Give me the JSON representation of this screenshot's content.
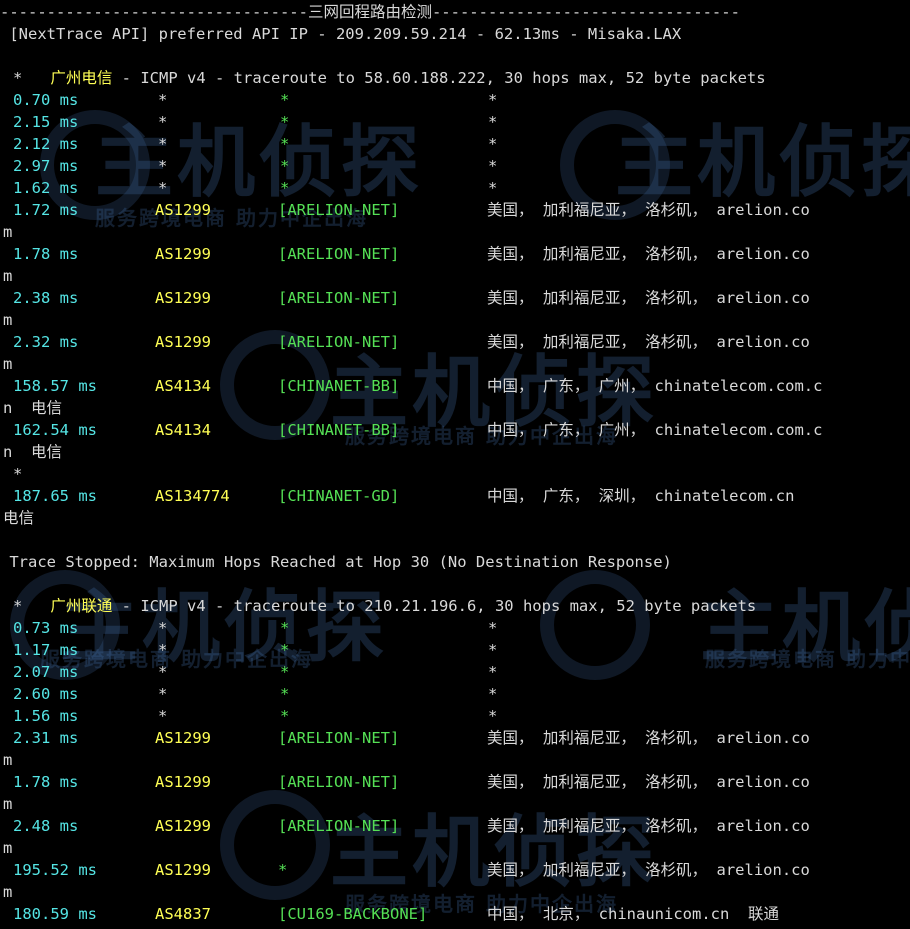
{
  "banner": "---------------------------------三网回程路由检测---------------------------------",
  "api_line": " [NextTrace API] preferred API IP - 209.209.59.214 - 62.13ms - Misaka.LAX",
  "sections": [
    {
      "carrier": "广州电信",
      "header_rest": " - ICMP v4 - traceroute to 58.60.188.222, 30 hops max, 52 byte packets",
      "icmp": "ICMP v4"
    },
    {
      "carrier": "广州联通",
      "header_rest": " - ICMP v4 - traceroute to 210.21.196.6, 30 hops max, 52 byte packets",
      "icmp": "ICMP v4"
    }
  ],
  "trace_stopped": " Trace Stopped: Maximum Hops Reached at Hop 30 (No Destination Response)",
  "star": "*",
  "rows1": [
    {
      "lat": "0.70 ms",
      "as": "*",
      "net": "*",
      "geo": "*"
    },
    {
      "lat": "2.15 ms",
      "as": "*",
      "net": "*",
      "geo": "*"
    },
    {
      "lat": "2.12 ms",
      "as": "*",
      "net": "*",
      "geo": "*"
    },
    {
      "lat": "2.97 ms",
      "as": "*",
      "net": "*",
      "geo": "*"
    },
    {
      "lat": "1.62 ms",
      "as": "*",
      "net": "*",
      "geo": "*"
    },
    {
      "lat": "1.72 ms",
      "as": "AS1299",
      "net": "[ARELION-NET]",
      "geo": "美国， 加利福尼亚， 洛杉矶， arelion.co",
      "wrap": "m"
    },
    {
      "lat": "1.78 ms",
      "as": "AS1299",
      "net": "[ARELION-NET]",
      "geo": "美国， 加利福尼亚， 洛杉矶， arelion.co",
      "wrap": "m"
    },
    {
      "lat": "2.38 ms",
      "as": "AS1299",
      "net": "[ARELION-NET]",
      "geo": "美国， 加利福尼亚， 洛杉矶， arelion.co",
      "wrap": "m"
    },
    {
      "lat": "2.32 ms",
      "as": "AS1299",
      "net": "[ARELION-NET]",
      "geo": "美国， 加利福尼亚， 洛杉矶， arelion.co",
      "wrap": "m"
    },
    {
      "lat": "158.57 ms",
      "as": "AS4134",
      "net": "[CHINANET-BB]",
      "geo": "中国， 广东， 广州， chinatelecom.com.c",
      "wrap": "n  电信"
    },
    {
      "lat": "162.54 ms",
      "as": "AS4134",
      "net": "[CHINANET-BB]",
      "geo": "中国， 广东， 广州， chinatelecom.com.c",
      "wrap": "n  电信"
    },
    {
      "lat": "187.65 ms",
      "as": "AS134774",
      "net": "[CHINANET-GD]",
      "geo": "中国， 广东， 深圳， chinatelecom.cn",
      "wrap": "电信"
    }
  ],
  "rows2": [
    {
      "lat": "0.73 ms",
      "as": "*",
      "net": "*",
      "geo": "*"
    },
    {
      "lat": "1.17 ms",
      "as": "*",
      "net": "*",
      "geo": "*"
    },
    {
      "lat": "2.07 ms",
      "as": "*",
      "net": "*",
      "geo": "*"
    },
    {
      "lat": "2.60 ms",
      "as": "*",
      "net": "*",
      "geo": "*"
    },
    {
      "lat": "1.56 ms",
      "as": "*",
      "net": "*",
      "geo": "*"
    },
    {
      "lat": "2.31 ms",
      "as": "AS1299",
      "net": "[ARELION-NET]",
      "geo": "美国， 加利福尼亚， 洛杉矶， arelion.co",
      "wrap": "m"
    },
    {
      "lat": "1.78 ms",
      "as": "AS1299",
      "net": "[ARELION-NET]",
      "geo": "美国， 加利福尼亚， 洛杉矶， arelion.co",
      "wrap": "m"
    },
    {
      "lat": "2.48 ms",
      "as": "AS1299",
      "net": "[ARELION-NET]",
      "geo": "美国， 加利福尼亚， 洛杉矶， arelion.co",
      "wrap": "m"
    },
    {
      "lat": "195.52 ms",
      "as": "AS1299",
      "net": "*",
      "geo": "美国， 加利福尼亚， 洛杉矶， arelion.co",
      "wrap": "m"
    },
    {
      "lat": "180.59 ms",
      "as": "AS4837",
      "net": "[CU169-BACKBONE]",
      "geo": "中国， 北京， chinaunicom.cn  联通"
    }
  ],
  "watermark": {
    "brand": "主机侦探",
    "slogan": "服务跨境电商 助力中企出海"
  }
}
